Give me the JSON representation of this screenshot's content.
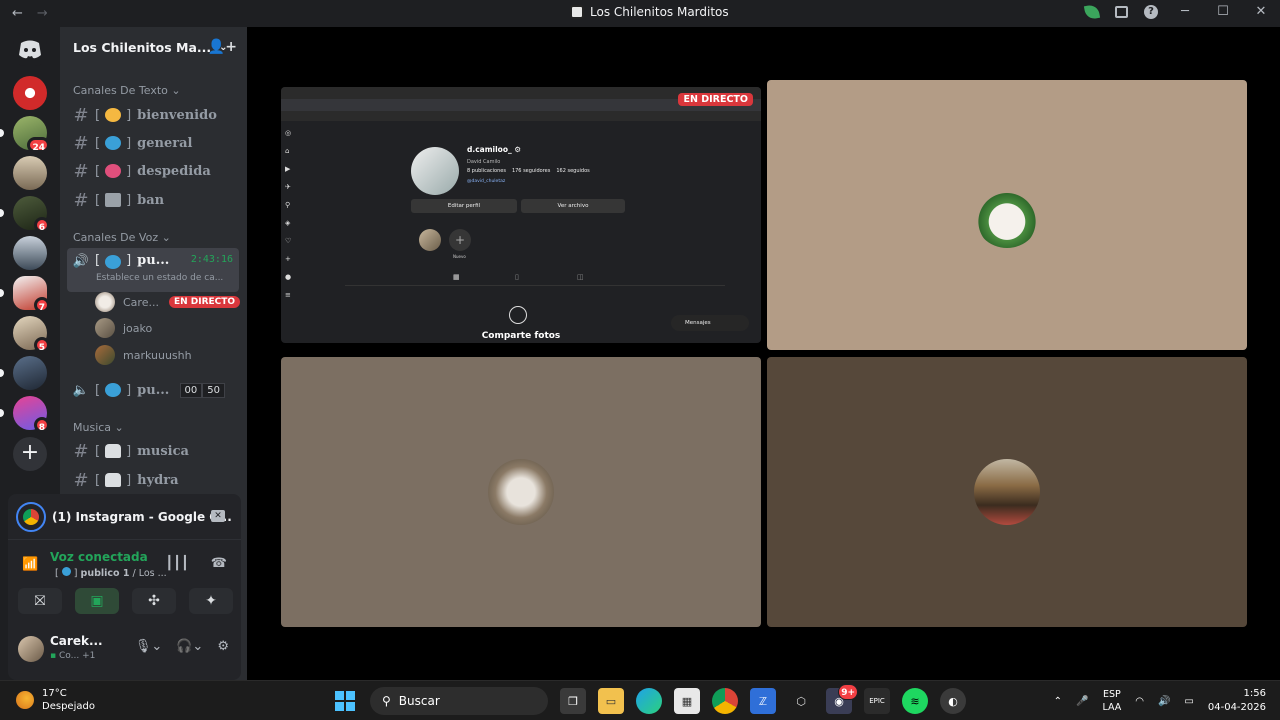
{
  "window": {
    "title": "Los Chilenitos Marditos",
    "back": "←",
    "forward": "→",
    "minimize": "─",
    "maximize": "☐",
    "close": "✕",
    "help": "?"
  },
  "servers": {
    "badges": [
      "24",
      "6",
      "7",
      "5",
      "8"
    ],
    "add": "+"
  },
  "guild": {
    "name": "Los Chilenitos Ma...",
    "chevron": "⌄",
    "invite_icon": "👤+"
  },
  "categories": {
    "text": "Canales De Texto",
    "voice": "Canales De Voz",
    "music": "Musica",
    "chev": "⌄"
  },
  "text_channels": [
    {
      "hash": "#",
      "name": "bienvenido",
      "bracket_open": "[",
      "bracket_close": "]"
    },
    {
      "hash": "#",
      "name": "general",
      "bracket_open": "[",
      "bracket_close": "]"
    },
    {
      "hash": "#",
      "name": "despedida",
      "bracket_open": "[",
      "bracket_close": "]"
    },
    {
      "hash": "#",
      "name": "ban",
      "bracket_open": "[",
      "bracket_close": "]"
    }
  ],
  "voice_active": {
    "name": "pu...",
    "timer": "2:43:16",
    "status": "Establece un estado de ca...",
    "bracket_open": "[",
    "bracket_close": "]"
  },
  "voice_users": [
    {
      "name": "Care...",
      "live": "EN DIRECTO"
    },
    {
      "name": "joako"
    },
    {
      "name": "markuuushh"
    }
  ],
  "voice_other": {
    "name": "pu...",
    "count": "00",
    "limit": "50",
    "bracket_open": "[",
    "bracket_close": "]"
  },
  "music_channels": [
    {
      "hash": "#",
      "name": "musica",
      "bracket_open": "[",
      "bracket_close": "]"
    },
    {
      "hash": "#",
      "name": "hydra",
      "bracket_open": "[",
      "bracket_close": "]"
    }
  ],
  "stream_panel": {
    "title": "(1) Instagram - Google C...",
    "close_icon": "✕"
  },
  "voice_status": {
    "label": "Voz conectada",
    "channel": "publico 1",
    "server": "/ Los ...",
    "bracket_open": "[",
    "bracket_close": "]"
  },
  "user": {
    "name": "Carek...",
    "status": "Co...",
    "extra": "+1"
  },
  "stage": {
    "live_badge": "EN DIRECTO",
    "instagram": {
      "username": "d.camiloo_",
      "fullname": "David Camilo",
      "posts": "8 publicaciones",
      "followers": "176 seguidores",
      "following": "162 seguidos",
      "link": "@david_chuletaz",
      "edit": "Editar perfil",
      "archive": "Ver archivo",
      "highlight_new": "Nuevo",
      "share": "Comparte fotos",
      "messages": "Mensajes"
    },
    "tile_colors": [
      "#b39c86",
      "#7c6f62",
      "#56483a"
    ]
  },
  "taskbar": {
    "temp": "17°C",
    "weather": "Despejado",
    "search": "Buscar",
    "lang1": "ESP",
    "lang2": "LAA",
    "time": "1:56",
    "date": "04-04-2026",
    "discord_badge": "9+"
  }
}
